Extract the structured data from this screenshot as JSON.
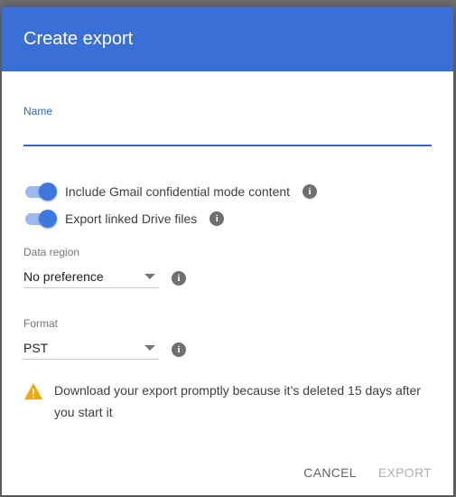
{
  "dialog": {
    "title": "Create export",
    "name_label": "Name",
    "name_value": "",
    "toggles": [
      {
        "label": "Include Gmail confidential mode content",
        "on": true
      },
      {
        "label": "Export linked Drive files",
        "on": true
      }
    ],
    "data_region": {
      "label": "Data region",
      "value": "No preference"
    },
    "format": {
      "label": "Format",
      "value": "PST"
    },
    "warning": "Download your export promptly because it’s deleted 15 days after you start it",
    "cancel_label": "CANCEL",
    "export_label": "EXPORT",
    "info_glyph": "i"
  },
  "colors": {
    "header": "#3a6fd8",
    "accent": "#2a66d0",
    "warning_icon": "#f5a800"
  }
}
